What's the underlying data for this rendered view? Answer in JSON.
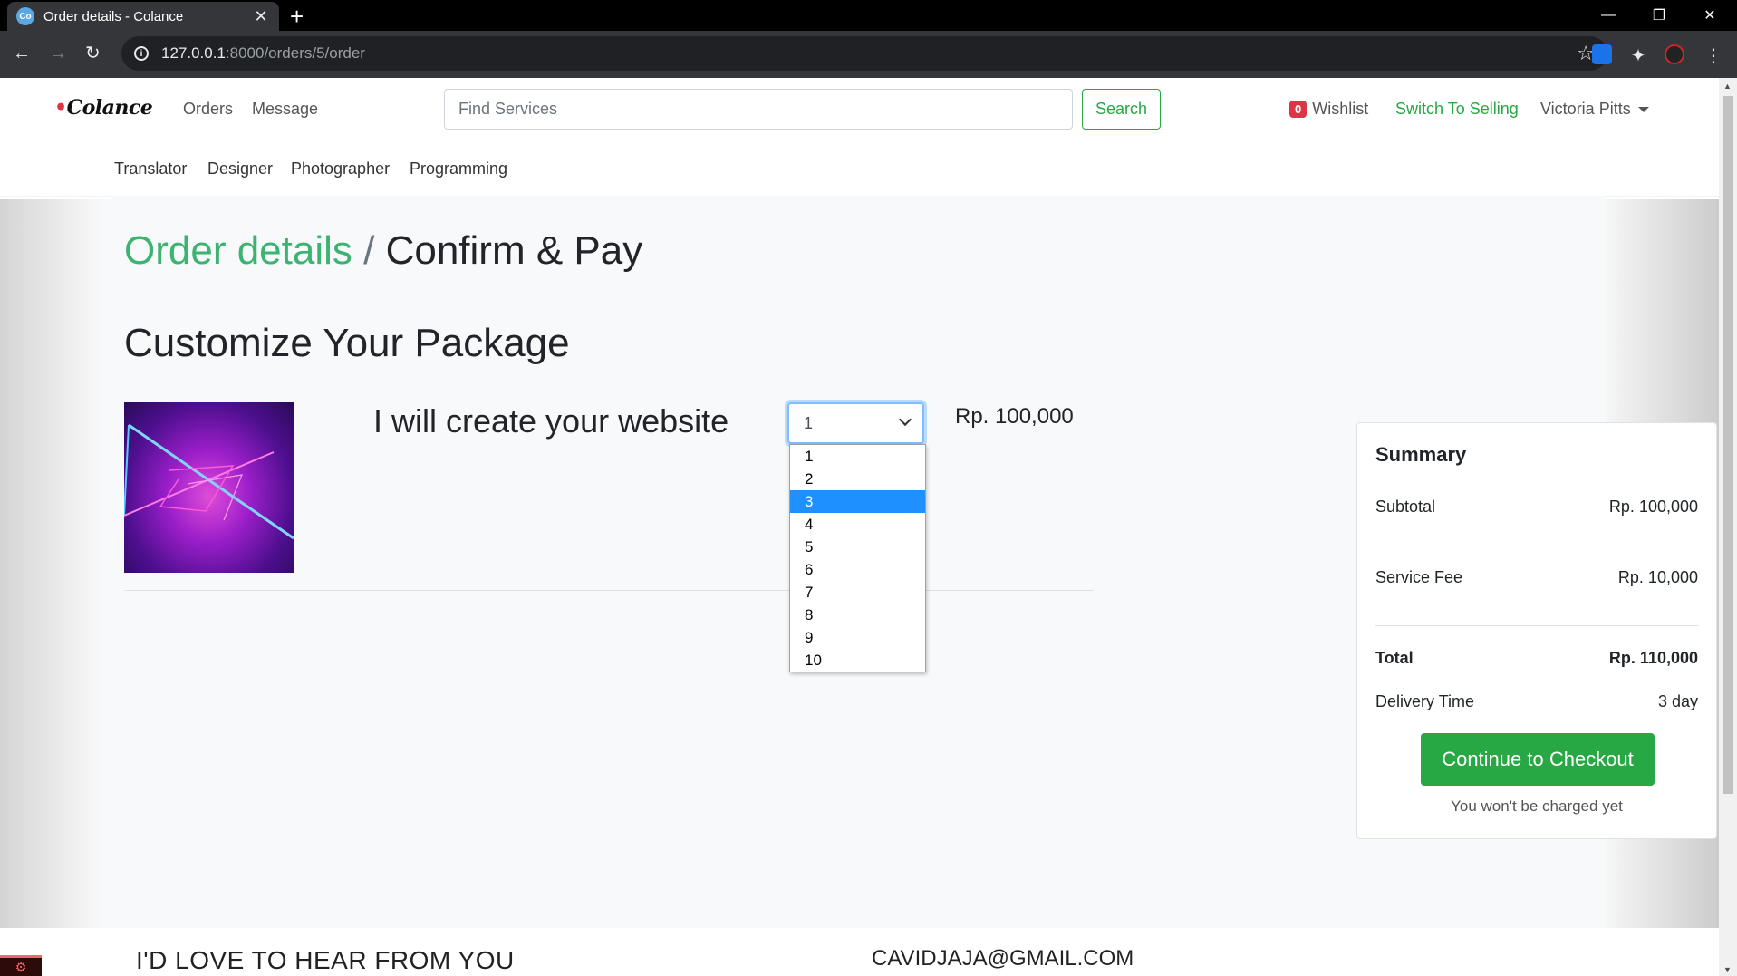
{
  "browser": {
    "tab_title": "Order details - Colance",
    "favicon_text": "Co",
    "url_host": "127.0.0.1",
    "url_path": ":8000/orders/5/order"
  },
  "site": {
    "logo": "Colance",
    "nav": {
      "orders": "Orders",
      "message": "Message"
    },
    "search": {
      "placeholder": "Find Services",
      "button": "Search"
    },
    "wishlist": {
      "count": "0",
      "label": "Wishlist"
    },
    "switch_label": "Switch To Selling",
    "user_name": "Victoria Pitts",
    "categories": [
      "Translator",
      "Designer",
      "Photographer",
      "Programming"
    ]
  },
  "page": {
    "breadcrumb_active": "Order details",
    "breadcrumb_sep": "/",
    "breadcrumb_current": "Confirm & Pay",
    "heading": "Customize Your Package",
    "package": {
      "title": "I will create your website",
      "quantity": "1",
      "price": "Rp. 100,000"
    },
    "quantity_options": [
      "1",
      "2",
      "3",
      "4",
      "5",
      "6",
      "7",
      "8",
      "9",
      "10"
    ],
    "highlighted_option": "3"
  },
  "summary": {
    "title": "Summary",
    "subtotal_label": "Subtotal",
    "subtotal_value": "Rp. 100,000",
    "fee_label": "Service Fee",
    "fee_value": "Rp. 10,000",
    "total_label": "Total",
    "total_value": "Rp. 110,000",
    "delivery_label": "Delivery Time",
    "delivery_value": "3 day",
    "checkout_button": "Continue to Checkout",
    "note": "You won't be charged yet"
  },
  "footer": {
    "left_text": "I'D LOVE TO HEAR FROM YOU",
    "email": "CAVIDJAJA@GMAIL.COM"
  }
}
